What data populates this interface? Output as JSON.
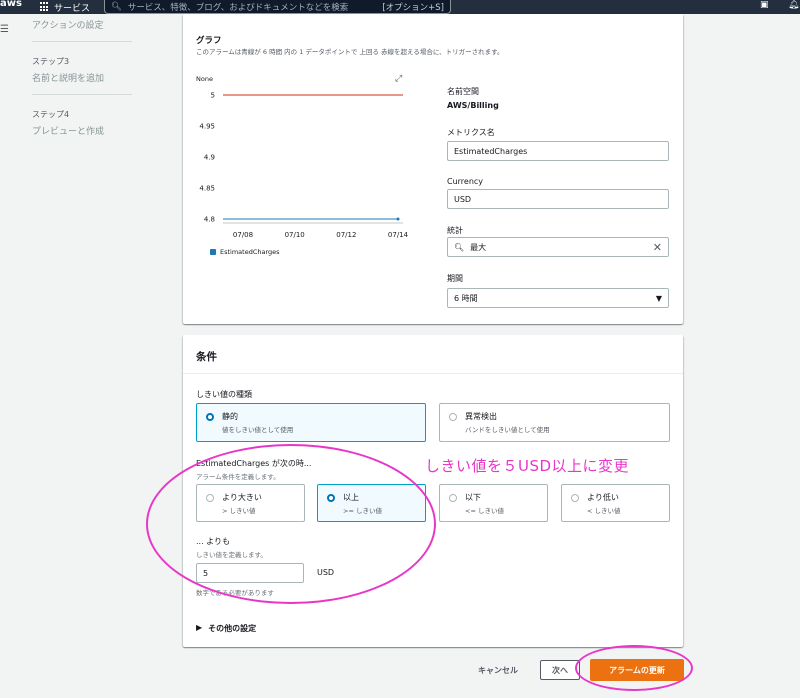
{
  "topnav": {
    "logo": "aws",
    "services": "サービス",
    "search_placeholder": "サービス、特徴、ブログ、およびドキュメントなどを検索",
    "search_hint": "[オプション+S]"
  },
  "leftnav": {
    "step2_link": "アクションの設定",
    "step3_title": "ステップ3",
    "step3_link": "名前と説明を追加",
    "step4_title": "ステップ4",
    "step4_link": "プレビューと作成"
  },
  "graph": {
    "title": "グラフ",
    "description": "このアラームは青線が 6 時間 内の 1 データポイントで 上回る 赤線を超える場合に、トリガーされます。",
    "legend": "EstimatedCharges"
  },
  "chart_data": {
    "type": "line",
    "title": "",
    "yunit_label": "None",
    "yticks": [
      "5",
      "4.95",
      "4.9",
      "4.85",
      "4.8"
    ],
    "ylim": [
      4.8,
      5.0
    ],
    "xticks": [
      "07/08",
      "07/10",
      "07/12",
      "07/14"
    ],
    "threshold": 5,
    "threshold_color": "#d13212",
    "series": [
      {
        "name": "EstimatedCharges",
        "color": "#1f77b4",
        "x": [
          "07/14"
        ],
        "values": [
          4.8
        ]
      }
    ],
    "legend_position": "bottom-left",
    "grid": false
  },
  "metric": {
    "namespace_label": "名前空間",
    "namespace_value": "AWS/Billing",
    "metric_name_label": "メトリクス名",
    "metric_name_value": "EstimatedCharges",
    "currency_label": "Currency",
    "currency_value": "USD",
    "statistic_label": "統計",
    "statistic_value": "最大",
    "period_label": "期間",
    "period_value": "6 時間"
  },
  "conditions": {
    "title": "条件",
    "threshold_type_label": "しきい値の種類",
    "static_label": "静的",
    "static_sub": "値をしきい値として使用",
    "anomaly_label": "異常検出",
    "anomaly_sub": "バンドをしきい値として使用",
    "when_label": "EstimatedCharges が次の時...",
    "when_sub": "アラーム条件を定義します。",
    "greater_label": "より大きい",
    "greater_sub": "> しきい値",
    "gte_label": "以上",
    "gte_sub": ">= しきい値",
    "lte_label": "以下",
    "lte_sub": "<= しきい値",
    "lt_label": "より低い",
    "lt_sub": "< しきい値",
    "than_label": "... よりも",
    "than_sub": "しきい値を定義します。",
    "threshold_value": "5",
    "threshold_unit": "USD",
    "threshold_hint": "数字である必要があります",
    "other_settings": "その他の設定"
  },
  "annotation": {
    "text": "しきい値を５USD以上に変更",
    "color": "#e837c8"
  },
  "footer": {
    "cancel": "キャンセル",
    "next": "次へ",
    "update": "アラームの更新"
  }
}
